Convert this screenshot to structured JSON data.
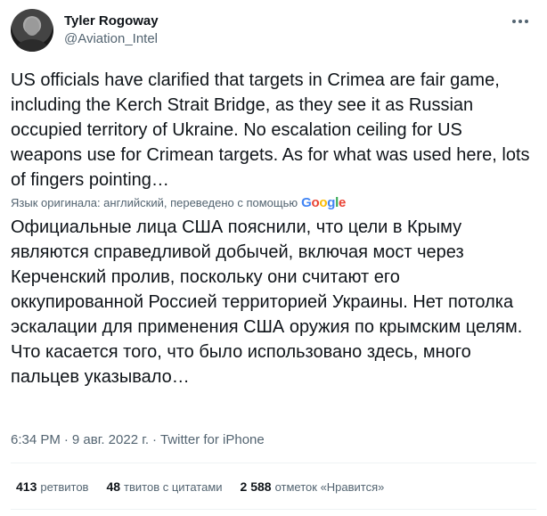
{
  "author": {
    "name": "Tyler Rogoway",
    "handle": "@Aviation_Intel"
  },
  "tweet": {
    "text": "US officials have clarified that targets in Crimea are fair game, including the Kerch Strait Bridge, as they see it as Russian occupied territory of Ukraine. No escalation ceiling for US weapons use for Crimean targets. As for what was used here, lots of fingers pointing…",
    "translation_note": "Язык оригинала: английский, переведено с помощью",
    "translation_provider": "Google",
    "translated_text": "Официальные лица США пояснили, что цели в Крыму являются справедливой добычей, включая мост через Керченский пролив, поскольку они считают его оккупированной Россией территорией Украины. Нет потолка эскалации для применения США оружия по крымским целям. Что касается того, что было использовано здесь, много пальцев указывало…"
  },
  "meta": {
    "time": "6:34 PM",
    "separator": "·",
    "date": "9 авг. 2022 г.",
    "source": "Twitter for iPhone"
  },
  "stats": {
    "retweets_count": "413",
    "retweets_label": "ретвитов",
    "quotes_count": "48",
    "quotes_label": "твитов с цитатами",
    "likes_count": "2 588",
    "likes_label": "отметок «Нравится»"
  },
  "icons": {
    "more": "more-horizontal-icon",
    "avatar": "user-avatar"
  },
  "colors": {
    "text_primary": "#0f1419",
    "text_secondary": "#536471",
    "divider": "#eff3f4"
  }
}
